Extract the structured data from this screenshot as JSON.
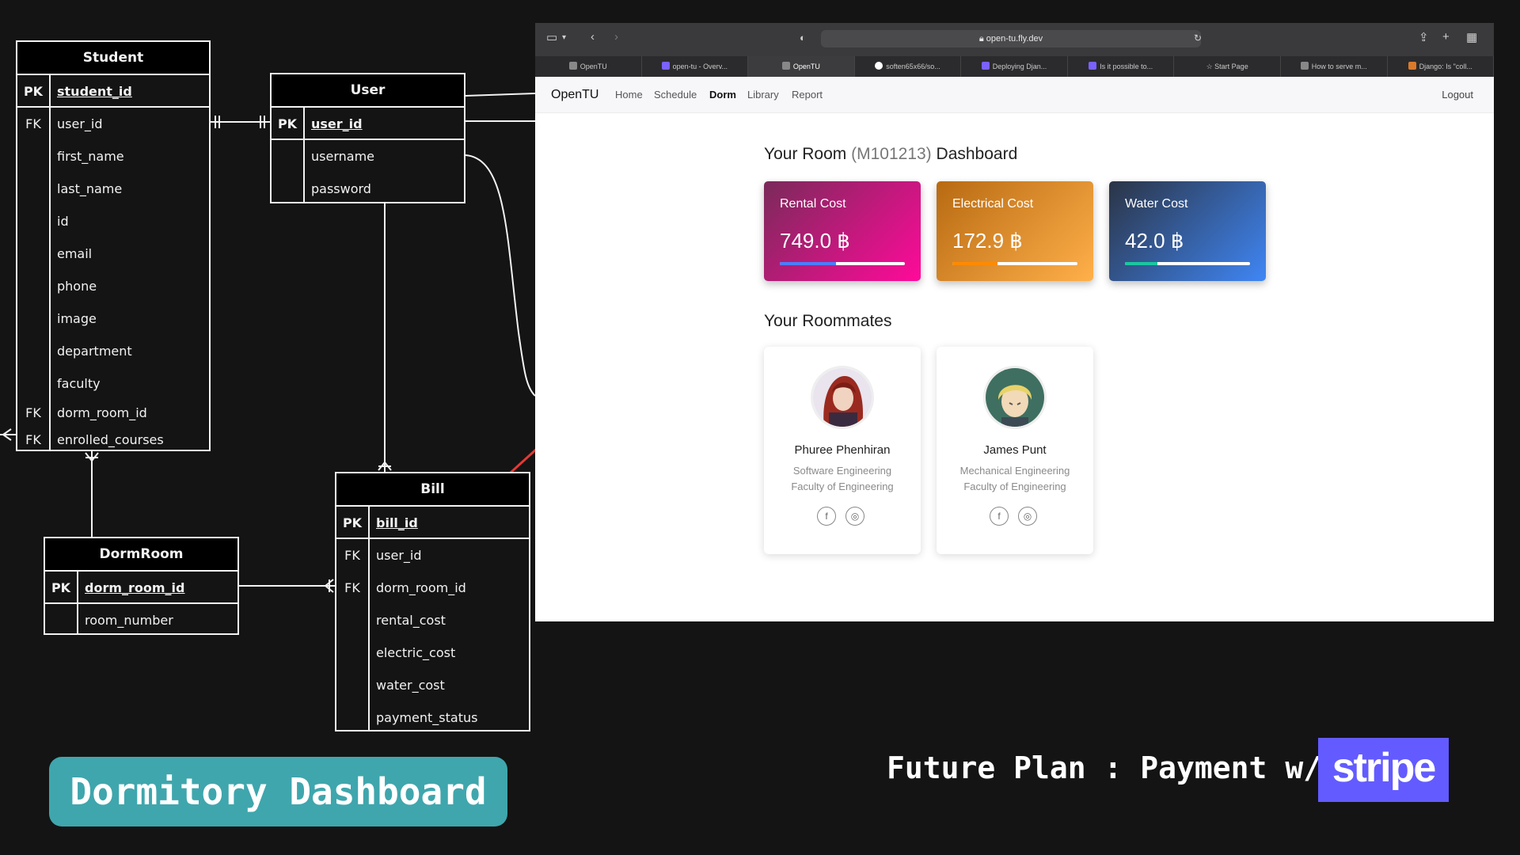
{
  "er": {
    "student": {
      "title": "Student",
      "pk": {
        "key": "PK",
        "name": "student_id"
      },
      "rows": [
        {
          "key": "FK",
          "name": "user_id"
        },
        {
          "key": "",
          "name": "first_name"
        },
        {
          "key": "",
          "name": "last_name"
        },
        {
          "key": "",
          "name": "id"
        },
        {
          "key": "",
          "name": "email"
        },
        {
          "key": "",
          "name": "phone"
        },
        {
          "key": "",
          "name": "image"
        },
        {
          "key": "",
          "name": "department"
        },
        {
          "key": "",
          "name": "faculty"
        },
        {
          "key": "FK",
          "name": "dorm_room_id"
        },
        {
          "key": "FK",
          "name": "enrolled_courses"
        }
      ]
    },
    "user": {
      "title": "User",
      "pk": {
        "key": "PK",
        "name": "user_id"
      },
      "rows": [
        {
          "key": "",
          "name": "username"
        },
        {
          "key": "",
          "name": "password"
        }
      ]
    },
    "dormroom": {
      "title": "DormRoom",
      "pk": {
        "key": "PK",
        "name": "dorm_room_id"
      },
      "rows": [
        {
          "key": "",
          "name": "room_number"
        }
      ]
    },
    "bill": {
      "title": "Bill",
      "pk": {
        "key": "PK",
        "name": "bill_id"
      },
      "rows": [
        {
          "key": "FK",
          "name": "user_id"
        },
        {
          "key": "FK",
          "name": "dorm_room_id"
        },
        {
          "key": "",
          "name": "rental_cost"
        },
        {
          "key": "",
          "name": "electric_cost"
        },
        {
          "key": "",
          "name": "water_cost"
        },
        {
          "key": "",
          "name": "payment_status"
        }
      ]
    }
  },
  "browser": {
    "url": "open-tu.fly.dev",
    "tabs": [
      "OpenTU",
      "open-tu - Overv...",
      "OpenTU",
      "soften65x66/so...",
      "Deploying Djan...",
      "Is it possible to...",
      "Start Page",
      "How to serve m...",
      "Django: Is \"coll..."
    ],
    "active_tab": 2
  },
  "nav": {
    "brand": "OpenTU",
    "links": [
      "Home",
      "Schedule",
      "Dorm",
      "Library",
      "Report"
    ],
    "active": "Dorm",
    "logout": "Logout"
  },
  "dashboard": {
    "title_pre": "Your Room ",
    "room": "(M101213)",
    "title_post": " Dashboard",
    "cards": [
      {
        "label": "Rental Cost",
        "value": "749.0 ฿",
        "progress": 0.45,
        "bg_from": "#7a2a5a",
        "bg_to": "#ff0a9a",
        "fill": "#4a7dff"
      },
      {
        "label": "Electrical Cost",
        "value": "172.9 ฿",
        "progress": 0.36,
        "bg_from": "#b86a12",
        "bg_to": "#ffb04a",
        "fill": "#ff8a00"
      },
      {
        "label": "Water Cost",
        "value": "42.0 ฿",
        "progress": 0.26,
        "bg_from": "#2b3445",
        "bg_to": "#3f86f5",
        "fill": "#1bc7a0"
      }
    ],
    "roommates_title": "Your Roommates",
    "roommates": [
      {
        "name": "Phuree Phenhiran",
        "major": "Software Engineering",
        "faculty": "Faculty of Engineering"
      },
      {
        "name": "James Punt",
        "major": "Mechanical Engineering",
        "faculty": "Faculty of Engineering"
      }
    ]
  },
  "badge": "Dormitory Dashboard",
  "future_plan": "Future Plan : Payment w/",
  "stripe": "stripe"
}
